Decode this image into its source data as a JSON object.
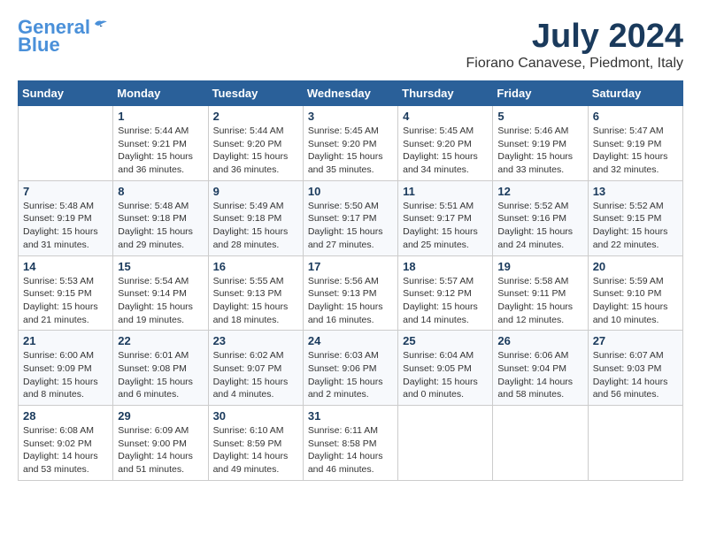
{
  "logo": {
    "line1": "General",
    "line2": "Blue"
  },
  "title": {
    "month_year": "July 2024",
    "location": "Fiorano Canavese, Piedmont, Italy"
  },
  "days_of_week": [
    "Sunday",
    "Monday",
    "Tuesday",
    "Wednesday",
    "Thursday",
    "Friday",
    "Saturday"
  ],
  "weeks": [
    [
      {
        "day": "",
        "info": ""
      },
      {
        "day": "1",
        "info": "Sunrise: 5:44 AM\nSunset: 9:21 PM\nDaylight: 15 hours\nand 36 minutes."
      },
      {
        "day": "2",
        "info": "Sunrise: 5:44 AM\nSunset: 9:20 PM\nDaylight: 15 hours\nand 36 minutes."
      },
      {
        "day": "3",
        "info": "Sunrise: 5:45 AM\nSunset: 9:20 PM\nDaylight: 15 hours\nand 35 minutes."
      },
      {
        "day": "4",
        "info": "Sunrise: 5:45 AM\nSunset: 9:20 PM\nDaylight: 15 hours\nand 34 minutes."
      },
      {
        "day": "5",
        "info": "Sunrise: 5:46 AM\nSunset: 9:19 PM\nDaylight: 15 hours\nand 33 minutes."
      },
      {
        "day": "6",
        "info": "Sunrise: 5:47 AM\nSunset: 9:19 PM\nDaylight: 15 hours\nand 32 minutes."
      }
    ],
    [
      {
        "day": "7",
        "info": "Sunrise: 5:48 AM\nSunset: 9:19 PM\nDaylight: 15 hours\nand 31 minutes."
      },
      {
        "day": "8",
        "info": "Sunrise: 5:48 AM\nSunset: 9:18 PM\nDaylight: 15 hours\nand 29 minutes."
      },
      {
        "day": "9",
        "info": "Sunrise: 5:49 AM\nSunset: 9:18 PM\nDaylight: 15 hours\nand 28 minutes."
      },
      {
        "day": "10",
        "info": "Sunrise: 5:50 AM\nSunset: 9:17 PM\nDaylight: 15 hours\nand 27 minutes."
      },
      {
        "day": "11",
        "info": "Sunrise: 5:51 AM\nSunset: 9:17 PM\nDaylight: 15 hours\nand 25 minutes."
      },
      {
        "day": "12",
        "info": "Sunrise: 5:52 AM\nSunset: 9:16 PM\nDaylight: 15 hours\nand 24 minutes."
      },
      {
        "day": "13",
        "info": "Sunrise: 5:52 AM\nSunset: 9:15 PM\nDaylight: 15 hours\nand 22 minutes."
      }
    ],
    [
      {
        "day": "14",
        "info": "Sunrise: 5:53 AM\nSunset: 9:15 PM\nDaylight: 15 hours\nand 21 minutes."
      },
      {
        "day": "15",
        "info": "Sunrise: 5:54 AM\nSunset: 9:14 PM\nDaylight: 15 hours\nand 19 minutes."
      },
      {
        "day": "16",
        "info": "Sunrise: 5:55 AM\nSunset: 9:13 PM\nDaylight: 15 hours\nand 18 minutes."
      },
      {
        "day": "17",
        "info": "Sunrise: 5:56 AM\nSunset: 9:13 PM\nDaylight: 15 hours\nand 16 minutes."
      },
      {
        "day": "18",
        "info": "Sunrise: 5:57 AM\nSunset: 9:12 PM\nDaylight: 15 hours\nand 14 minutes."
      },
      {
        "day": "19",
        "info": "Sunrise: 5:58 AM\nSunset: 9:11 PM\nDaylight: 15 hours\nand 12 minutes."
      },
      {
        "day": "20",
        "info": "Sunrise: 5:59 AM\nSunset: 9:10 PM\nDaylight: 15 hours\nand 10 minutes."
      }
    ],
    [
      {
        "day": "21",
        "info": "Sunrise: 6:00 AM\nSunset: 9:09 PM\nDaylight: 15 hours\nand 8 minutes."
      },
      {
        "day": "22",
        "info": "Sunrise: 6:01 AM\nSunset: 9:08 PM\nDaylight: 15 hours\nand 6 minutes."
      },
      {
        "day": "23",
        "info": "Sunrise: 6:02 AM\nSunset: 9:07 PM\nDaylight: 15 hours\nand 4 minutes."
      },
      {
        "day": "24",
        "info": "Sunrise: 6:03 AM\nSunset: 9:06 PM\nDaylight: 15 hours\nand 2 minutes."
      },
      {
        "day": "25",
        "info": "Sunrise: 6:04 AM\nSunset: 9:05 PM\nDaylight: 15 hours\nand 0 minutes."
      },
      {
        "day": "26",
        "info": "Sunrise: 6:06 AM\nSunset: 9:04 PM\nDaylight: 14 hours\nand 58 minutes."
      },
      {
        "day": "27",
        "info": "Sunrise: 6:07 AM\nSunset: 9:03 PM\nDaylight: 14 hours\nand 56 minutes."
      }
    ],
    [
      {
        "day": "28",
        "info": "Sunrise: 6:08 AM\nSunset: 9:02 PM\nDaylight: 14 hours\nand 53 minutes."
      },
      {
        "day": "29",
        "info": "Sunrise: 6:09 AM\nSunset: 9:00 PM\nDaylight: 14 hours\nand 51 minutes."
      },
      {
        "day": "30",
        "info": "Sunrise: 6:10 AM\nSunset: 8:59 PM\nDaylight: 14 hours\nand 49 minutes."
      },
      {
        "day": "31",
        "info": "Sunrise: 6:11 AM\nSunset: 8:58 PM\nDaylight: 14 hours\nand 46 minutes."
      },
      {
        "day": "",
        "info": ""
      },
      {
        "day": "",
        "info": ""
      },
      {
        "day": "",
        "info": ""
      }
    ]
  ]
}
